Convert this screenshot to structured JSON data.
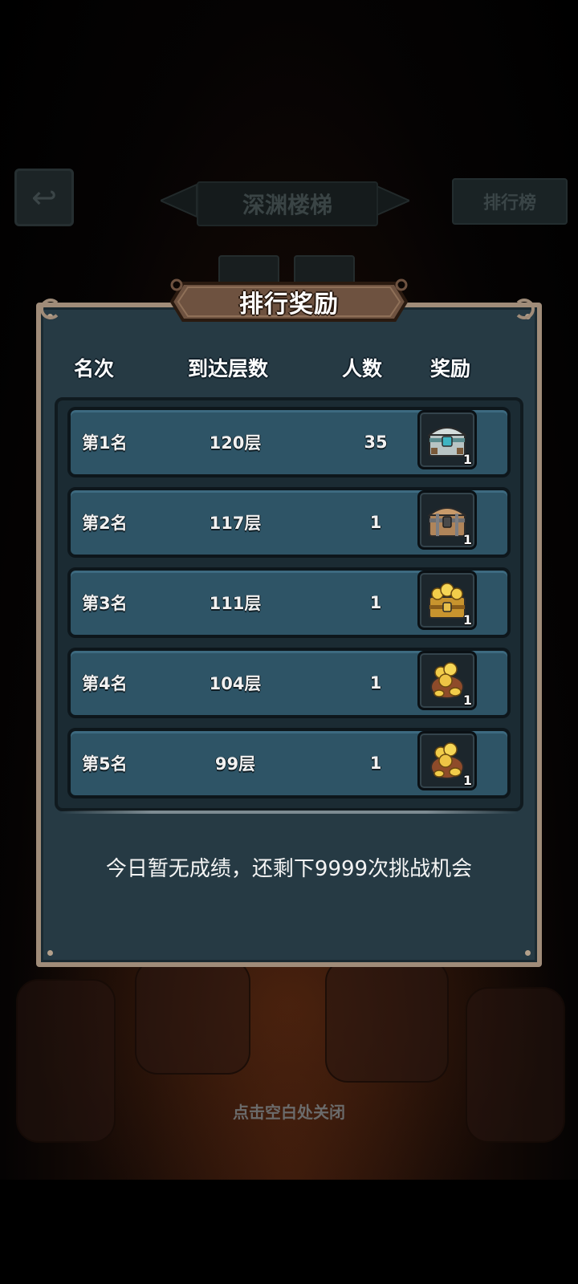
{
  "background": {
    "screen_title": "深渊楼梯",
    "leaderboard_button": "排行榜",
    "close_hint": "点击空白处关闭"
  },
  "modal": {
    "title": "排行奖励",
    "headers": {
      "rank": "名次",
      "floor": "到达层数",
      "count": "人数",
      "reward": "奖励"
    },
    "rows": [
      {
        "rank": "第1名",
        "floor": "120层",
        "count": "35",
        "reward_qty": "1",
        "reward_icon": "silver-chest-icon"
      },
      {
        "rank": "第2名",
        "floor": "117层",
        "count": "1",
        "reward_qty": "1",
        "reward_icon": "wooden-chest-icon"
      },
      {
        "rank": "第3名",
        "floor": "111层",
        "count": "1",
        "reward_qty": "1",
        "reward_icon": "gold-chest-icon"
      },
      {
        "rank": "第4名",
        "floor": "104层",
        "count": "1",
        "reward_qty": "1",
        "reward_icon": "gold-sack-icon"
      },
      {
        "rank": "第5名",
        "floor": "99层",
        "count": "1",
        "reward_qty": "1",
        "reward_icon": "gold-sack-icon"
      }
    ],
    "status": "今日暂无成绩，还剩下9999次挑战机会"
  },
  "colors": {
    "panel": "#263a44",
    "row": "#2e5466",
    "frame_border": "#a08c79",
    "title_plate": "#6e5240"
  }
}
